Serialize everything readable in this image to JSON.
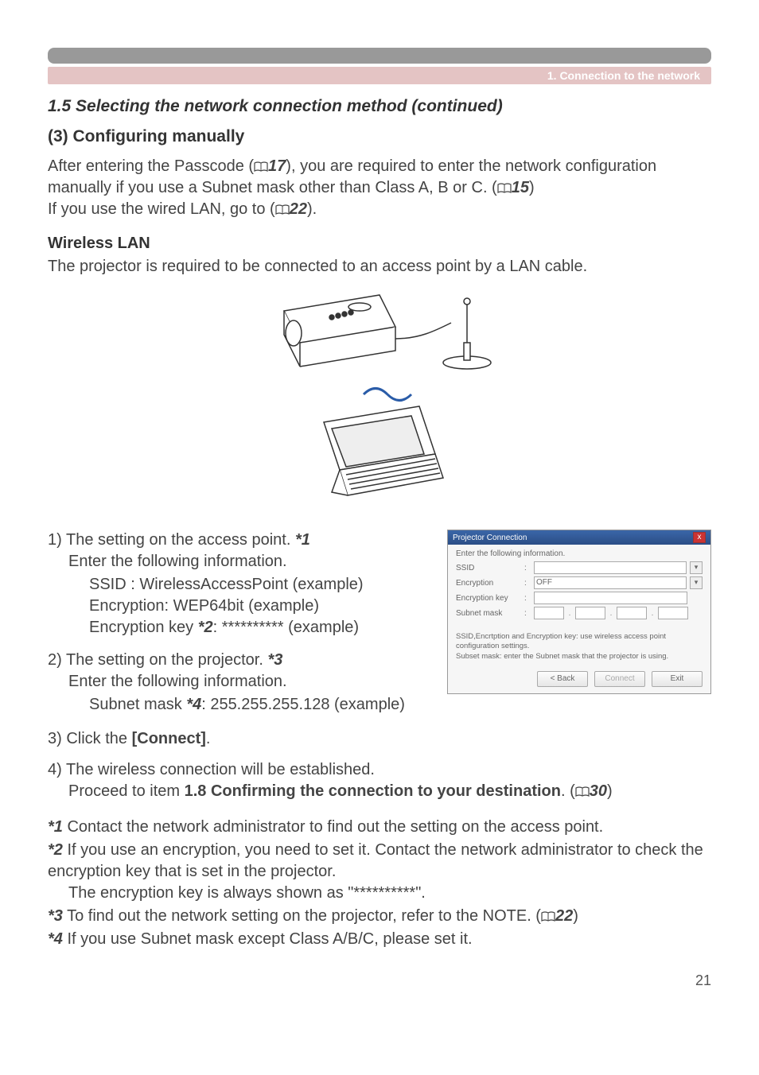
{
  "sectionBar": "1. Connection to the network",
  "title": "1.5 Selecting the network connection method (continued)",
  "sub3": "(3) Configuring manually",
  "para1_a": "After entering the Passcode (",
  "ref17": "17",
  "para1_b": "), you are required to enter the network configuration manually if you use a Subnet mask other than Class A, B or C. (",
  "ref15": "15",
  "para1_c": ")",
  "para1_d": "If you use the wired LAN, go to (",
  "ref22": "22",
  "para1_e": ").",
  "wlanHeading": "Wireless LAN",
  "wlanPara": "The projector is required to be connected to an access point by a LAN cable.",
  "step1_line1a": "1) The setting on the access point. ",
  "step1_star": "*1",
  "step1_line2": "Enter the following information.",
  "step1_ssid": "SSID : WirelessAccessPoint (example)",
  "step1_enc": "Encryption: WEP64bit (example)",
  "step1_key_a": "Encryption key ",
  "step1_key_star": "*2",
  "step1_key_b": ": ********** (example)",
  "step2_line1a": "2) The setting on the projector. ",
  "step2_star": "*3",
  "step2_line2": "Enter the following information.",
  "step2_mask_a": "Subnet mask ",
  "step2_mask_star": "*4",
  "step2_mask_b": ": 255.255.255.128 (example)",
  "step3_a": "3) Click the ",
  "step3_b": "[Connect]",
  "step3_c": ".",
  "step4_line1": "4) The wireless connection will be established.",
  "step4_line2a": "Proceed to item ",
  "step4_line2b": "1.8 Confirming the connection to your destination",
  "step4_line2c": ". (",
  "ref30": "30",
  "step4_line2d": ")",
  "fn1_star": "*1",
  "fn1": " Contact the network administrator to find out the setting on the access point.",
  "fn2_star": "*2",
  "fn2a": " If you use an encryption, you need to set it. Contact the network administrator to check the encryption key that is set in the projector.",
  "fn2b": "The encryption key is always shown as \"**********\".",
  "fn3_star": "*3",
  "fn3a": " To find out the network setting on the projector, refer to the NOTE. (",
  "fn3b": ")",
  "fn4_star": "*4",
  "fn4": " If you use Subnet mask except Class A/B/C, please set it.",
  "pageNum": "21",
  "dialog": {
    "title": "Projector Connection",
    "instr": "Enter the following information.",
    "lblSSID": "SSID",
    "lblEnc": "Encryption",
    "valEnc": "OFF",
    "lblKey": "Encryption key",
    "lblMask": "Subnet mask",
    "note1": "SSID,Encrtption and Encryption key: use wireless access point configuration settings.",
    "note2": "Subset mask: enter the Subnet mask that the projector is using.",
    "btnBack": "< Back",
    "btnConnect": "Connect",
    "btnExit": "Exit"
  }
}
